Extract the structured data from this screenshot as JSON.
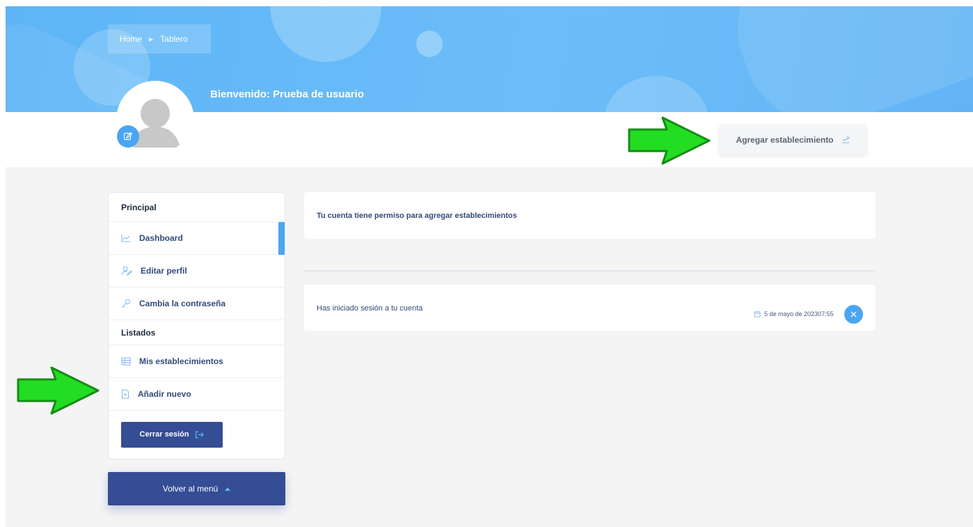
{
  "breadcrumb": {
    "home": "Home",
    "current": "Tablero"
  },
  "header": {
    "welcome": "Bienvenido: Prueba de usuario"
  },
  "actions": {
    "add_establishment": "Agregar establecimiento"
  },
  "sidebar": {
    "section_principal": "Principal",
    "items_principal": [
      {
        "label": "Dashboard",
        "icon": "chart-icon",
        "active": true
      },
      {
        "label": "Editar perfil",
        "icon": "user-edit-icon"
      },
      {
        "label": "Cambia la contraseña",
        "icon": "key-icon"
      }
    ],
    "section_listados": "Listados",
    "items_listados": [
      {
        "label": "Mis establecimientos",
        "icon": "table-icon"
      },
      {
        "label": "Añadir nuevo",
        "icon": "file-add-icon"
      }
    ],
    "logout": "Cerrar sesión"
  },
  "back_menu": "Volver al menú",
  "notifications": {
    "permission": "Tu cuenta tiene permiso para agregar establecimientos",
    "login": {
      "message": "Has iniciado sesión a tu cuenta",
      "date": "5 de mayo de 202307:55"
    }
  },
  "colors": {
    "accent": "#4aa5f2",
    "primary": "#344d94",
    "hero": "#6cbdf8",
    "arrow": "#22dd22"
  }
}
